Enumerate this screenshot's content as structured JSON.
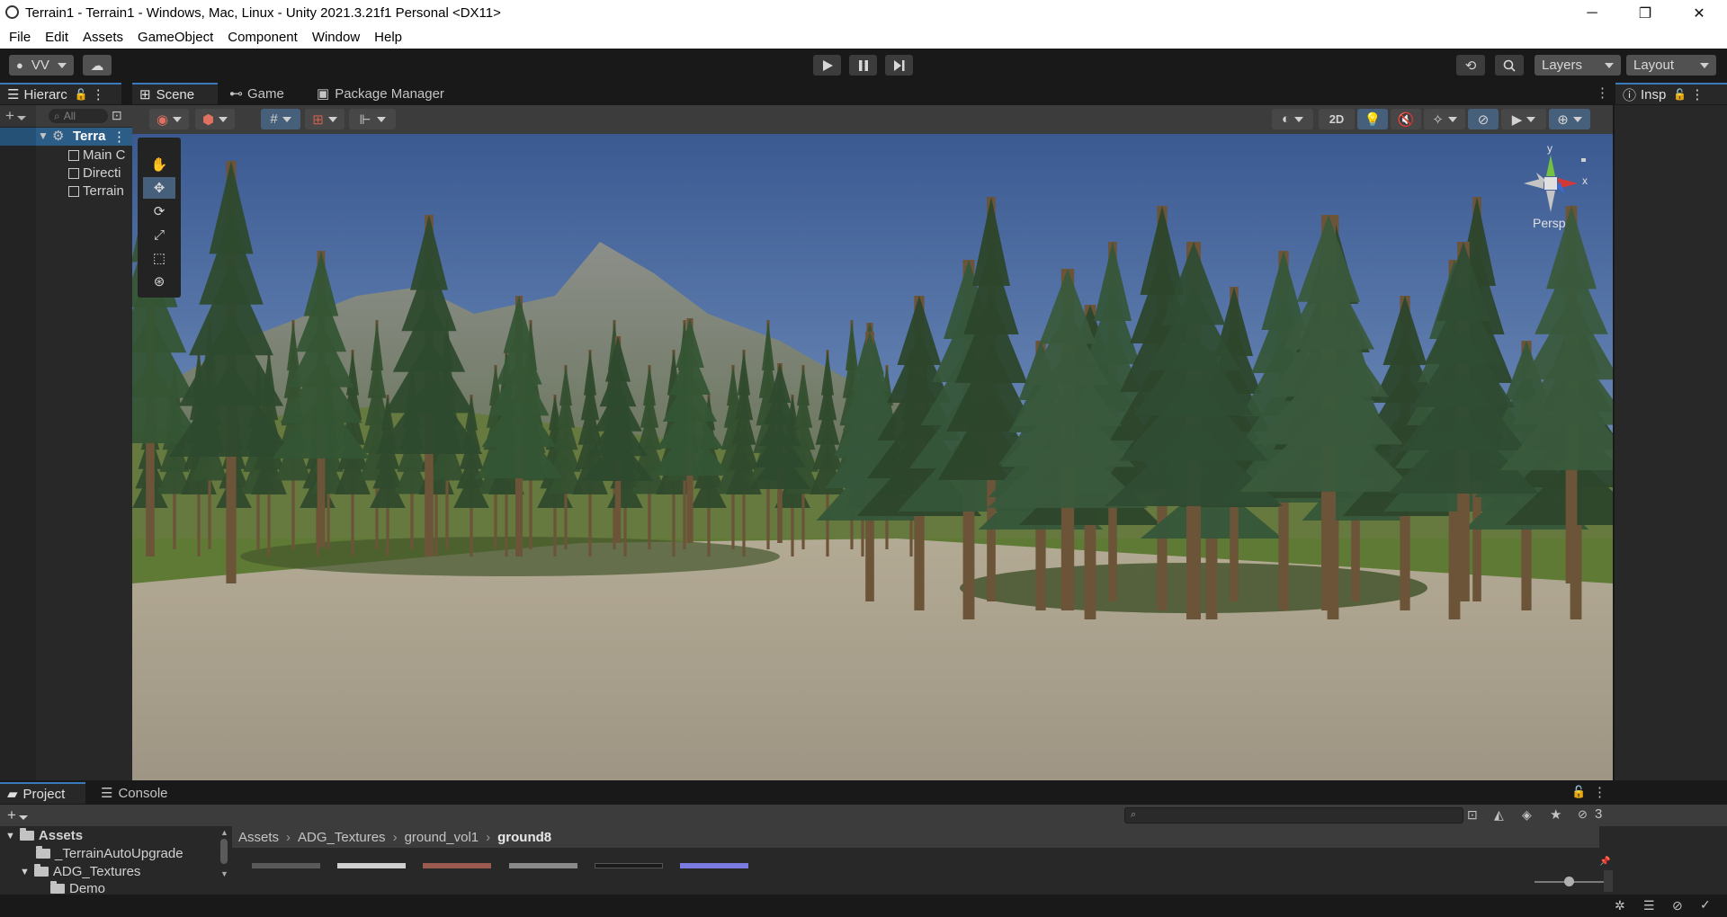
{
  "window": {
    "title": "Terrain1 - Terrain1 - Windows, Mac, Linux - Unity 2021.3.21f1 Personal <DX11>",
    "minimize": "─",
    "restore": "❐",
    "close": "✕"
  },
  "menu": [
    "File",
    "Edit",
    "Assets",
    "GameObject",
    "Component",
    "Window",
    "Help"
  ],
  "toolbar": {
    "account": "VV",
    "layers": "Layers",
    "layout": "Layout",
    "play_icon": "play-icon",
    "pause_icon": "pause-icon",
    "step_icon": "step-icon"
  },
  "hierarchy": {
    "tab_label": "Hierarc",
    "search_placeholder": "All",
    "scene": "Terra",
    "items": [
      "Main C",
      "Directi",
      "Terrain"
    ]
  },
  "scene_tabs": {
    "scene": "Scene",
    "game": "Game",
    "package_manager": "Package Manager"
  },
  "scene_view": {
    "mode_2d": "2D",
    "gizmo_projection": "Persp",
    "axis_y": "y",
    "axis_x": "x"
  },
  "inspector": {
    "tab_label": "Insp"
  },
  "bottom": {
    "project_tab": "Project",
    "console_tab": "Console",
    "hidden_count": "3",
    "breadcrumb": [
      "Assets",
      "ADG_Textures",
      "ground_vol1",
      "ground8"
    ],
    "tree": [
      {
        "label": "Assets",
        "bold": true
      },
      {
        "label": "_TerrainAutoUpgrade"
      },
      {
        "label": "ADG_Textures"
      },
      {
        "label": "Demo"
      }
    ]
  },
  "colors": {
    "accent": "#3a79bb",
    "panel": "#282828",
    "sky_top": "#3f5f96",
    "sky_bottom": "#8aa3c4",
    "ground": "#a39a86",
    "grass": "#5f7a35"
  }
}
